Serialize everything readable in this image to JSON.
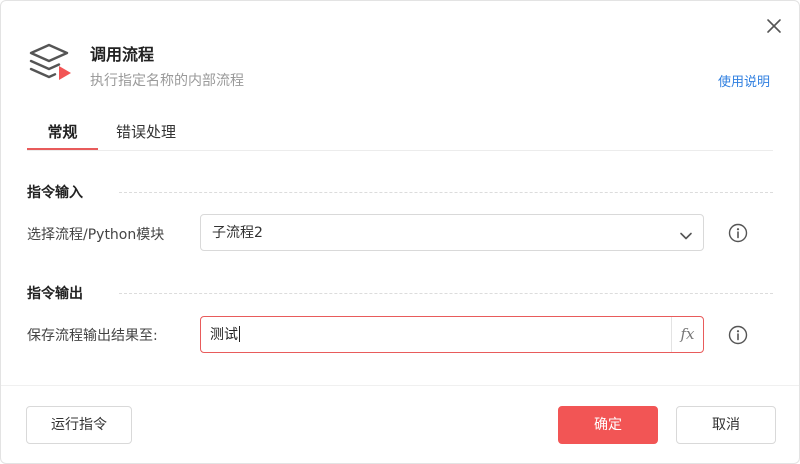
{
  "header": {
    "title": "调用流程",
    "subtitle": "执行指定名称的内部流程",
    "help_link": "使用说明",
    "icon": "layers-play-icon"
  },
  "tabs": [
    {
      "label": "常规",
      "active": true
    },
    {
      "label": "错误处理",
      "active": false
    }
  ],
  "input_section": {
    "heading": "指令输入",
    "field_label": "选择流程/Python模块",
    "selected_value": "子流程2"
  },
  "output_section": {
    "heading": "指令输出",
    "field_label": "保存流程输出结果至:",
    "value": "测试",
    "fx_label": "fx"
  },
  "footer": {
    "run_label": "运行指令",
    "ok_label": "确定",
    "cancel_label": "取消"
  },
  "colors": {
    "accent": "#f25555",
    "link": "#2f7fe0",
    "icon_gray": "#555555"
  }
}
